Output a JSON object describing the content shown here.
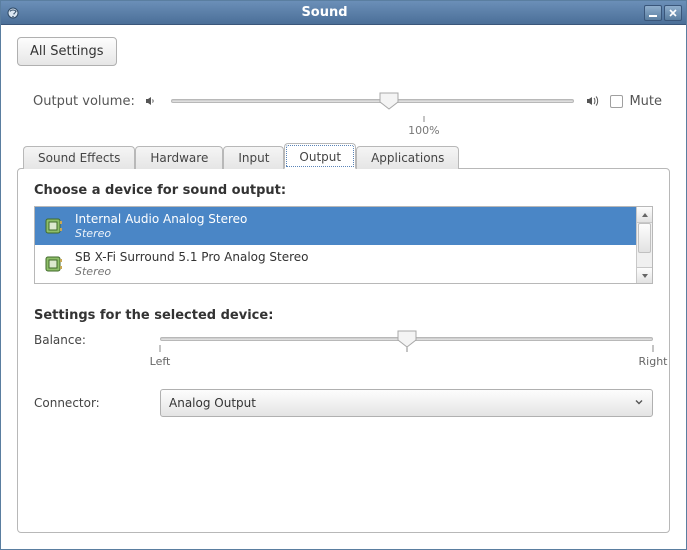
{
  "window": {
    "title": "Sound"
  },
  "toolbar": {
    "all_settings": "All Settings"
  },
  "volume": {
    "label": "Output volume:",
    "mute_label": "Mute",
    "mute_checked": false,
    "value_percent": 54,
    "tick_label": "100%"
  },
  "tabs": [
    {
      "id": "sound-effects",
      "label": "Sound Effects",
      "active": false
    },
    {
      "id": "hardware",
      "label": "Hardware",
      "active": false
    },
    {
      "id": "input",
      "label": "Input",
      "active": false
    },
    {
      "id": "output",
      "label": "Output",
      "active": true
    },
    {
      "id": "applications",
      "label": "Applications",
      "active": false
    }
  ],
  "output_panel": {
    "choose_heading": "Choose a device for sound output:",
    "devices": [
      {
        "name": "Internal Audio Analog Stereo",
        "subtitle": "Stereo",
        "selected": true
      },
      {
        "name": "SB X-Fi Surround 5.1 Pro Analog Stereo",
        "subtitle": "Stereo",
        "selected": false
      }
    ],
    "settings_heading": "Settings for the selected device:",
    "balance": {
      "label": "Balance:",
      "left_label": "Left",
      "right_label": "Right",
      "value_percent": 50
    },
    "connector": {
      "label": "Connector:",
      "selected": "Analog Output"
    }
  },
  "colors": {
    "selection": "#4a86c6",
    "titlebar_top": "#6b8fb8",
    "titlebar_bottom": "#4b6f98"
  }
}
